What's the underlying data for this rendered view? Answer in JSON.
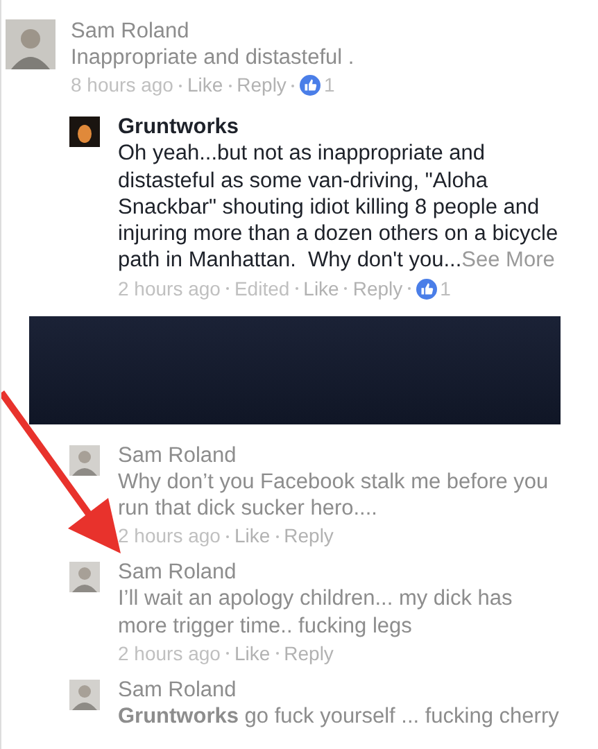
{
  "thread": {
    "author": "Sam Roland",
    "avatar": {
      "kind": "person"
    },
    "faded": true,
    "text": "Inappropriate and distasteful .",
    "meta": [
      {
        "label": "8 hours ago",
        "kind": "time"
      },
      {
        "label": "Like",
        "kind": "action"
      },
      {
        "label": "Reply",
        "kind": "action"
      }
    ],
    "reactions": "1",
    "children": [
      {
        "kind": "reply",
        "author": "Gruntworks",
        "avatar": {
          "kind": "dark"
        },
        "faded": false,
        "text": "Oh yeah...but not as inappropriate and distasteful as some van-driving, \"Aloha Snackbar\" shouting idiot killing 8 people and injuring more than a dozen others on a bicycle path in Manhattan.  Why don't you...",
        "see_more": "See More",
        "meta": [
          {
            "label": "2 hours ago",
            "kind": "time"
          },
          {
            "label": "Edited",
            "kind": "note"
          },
          {
            "label": "Like",
            "kind": "action"
          },
          {
            "label": "Reply",
            "kind": "action"
          }
        ],
        "reactions": "1"
      },
      {
        "kind": "redacted"
      },
      {
        "kind": "reply",
        "author": "Sam Roland",
        "avatar": {
          "kind": "person"
        },
        "faded": true,
        "text": "Why don’t you Facebook stalk me before you run that dick sucker hero....",
        "meta": [
          {
            "label": "2 hours ago",
            "kind": "time"
          },
          {
            "label": "Like",
            "kind": "action"
          },
          {
            "label": "Reply",
            "kind": "action"
          }
        ]
      },
      {
        "kind": "reply",
        "author": "Sam Roland",
        "avatar": {
          "kind": "person"
        },
        "faded": true,
        "text": "I’ll wait an apology children... my dick has more trigger time.. fucking legs",
        "meta": [
          {
            "label": "2 hours ago",
            "kind": "time"
          },
          {
            "label": "Like",
            "kind": "action"
          },
          {
            "label": "Reply",
            "kind": "action"
          }
        ]
      },
      {
        "kind": "reply",
        "author": "Sam Roland",
        "avatar": {
          "kind": "person"
        },
        "faded": true,
        "text": "**Gruntworks** go fuck yourself ... fucking cherry"
      }
    ]
  },
  "annotation": {
    "kind": "arrow"
  }
}
